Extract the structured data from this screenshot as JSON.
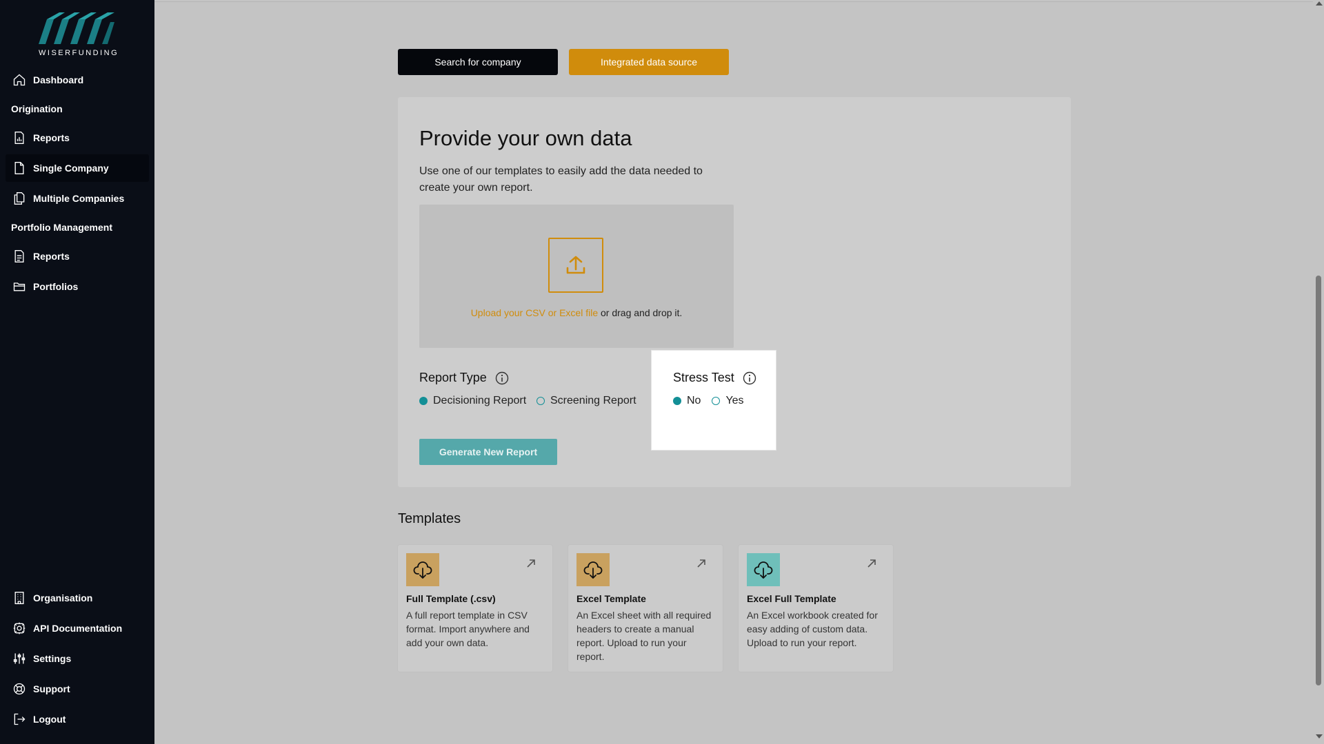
{
  "app": {
    "logo_text": "WISERFUNDING"
  },
  "sidebar": {
    "items": [
      {
        "label": "Dashboard",
        "icon": "home-icon"
      },
      {
        "label": "Reports",
        "icon": "bar-chart-file-icon"
      },
      {
        "label": "Single Company",
        "icon": "file-icon"
      },
      {
        "label": "Multiple Companies",
        "icon": "files-icon"
      },
      {
        "label": "Reports",
        "icon": "document-icon"
      },
      {
        "label": "Portfolios",
        "icon": "folders-icon"
      },
      {
        "label": "Organisation",
        "icon": "building-icon"
      },
      {
        "label": "API Documentation",
        "icon": "gear-icon"
      },
      {
        "label": "Settings",
        "icon": "sliders-icon"
      },
      {
        "label": "Support",
        "icon": "lifebuoy-icon"
      },
      {
        "label": "Logout",
        "icon": "logout-icon"
      }
    ],
    "sections": {
      "origination": "Origination",
      "portfolio_management": "Portfolio Management"
    },
    "active_item": "Single Company"
  },
  "toolbar": {
    "search_label": "Search for company",
    "integrated_label": "Integrated data source"
  },
  "main": {
    "title": "Provide your own data",
    "description": "Use one of our templates to easily add the data needed to create your own report.",
    "upload": {
      "link_text": "Upload your CSV or Excel file",
      "suffix_text": " or drag and drop it."
    },
    "report_type": {
      "label": "Report Type",
      "options": [
        "Decisioning Report",
        "Screening Report"
      ],
      "selected": "Decisioning Report"
    },
    "stress_test": {
      "label": "Stress Test",
      "options": [
        "No",
        "Yes"
      ],
      "selected": "No"
    },
    "generate_label": "Generate New Report"
  },
  "templates": {
    "title": "Templates",
    "items": [
      {
        "name": "Full Template (.csv)",
        "description": "A full report template in CSV format. Import anywhere and add your own data.",
        "color": "#c9a15f"
      },
      {
        "name": "Excel Template",
        "description": "An Excel sheet with all required headers to create a manual report. Upload to run your report.",
        "color": "#c9a15f"
      },
      {
        "name": "Excel Full Template",
        "description": "An Excel workbook created for easy adding of custom data. Upload to run your report.",
        "color": "#6fbfba"
      }
    ]
  },
  "colors": {
    "sidebar_bg": "#0a0e17",
    "accent_orange": "#d08c0c",
    "accent_teal": "#138f96",
    "generate_button": "#55a8aa"
  }
}
